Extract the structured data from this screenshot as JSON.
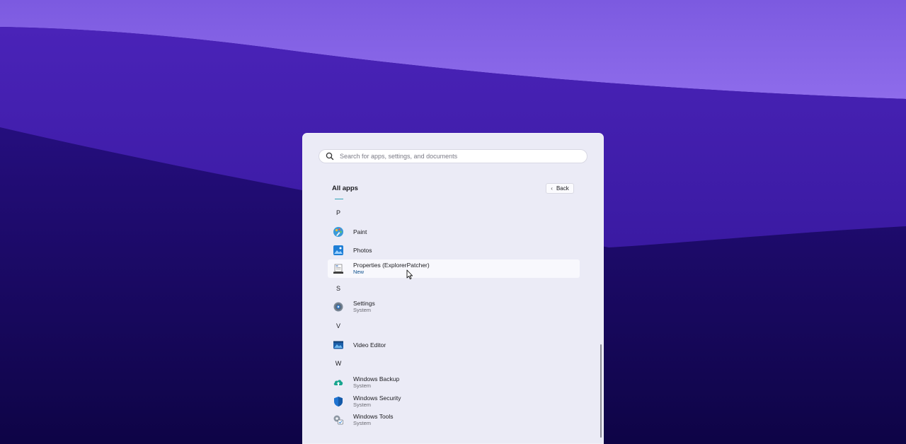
{
  "search": {
    "placeholder": "Search for apps, settings, and documents"
  },
  "header": {
    "title": "All apps",
    "back_label": "Back"
  },
  "groups": [
    {
      "letter": "P",
      "apps": [
        {
          "name": "Paint",
          "sub": "",
          "icon": "paint-icon"
        },
        {
          "name": "Photos",
          "sub": "",
          "icon": "photos-icon"
        },
        {
          "name": "Properties (ExplorerPatcher)",
          "sub": "New",
          "icon": "properties-icon"
        }
      ]
    },
    {
      "letter": "S",
      "apps": [
        {
          "name": "Settings",
          "sub": "System",
          "icon": "settings-icon"
        }
      ]
    },
    {
      "letter": "V",
      "apps": [
        {
          "name": "Video Editor",
          "sub": "",
          "icon": "video-editor-icon"
        }
      ]
    },
    {
      "letter": "W",
      "apps": [
        {
          "name": "Windows Backup",
          "sub": "System",
          "icon": "backup-icon"
        },
        {
          "name": "Windows Security",
          "sub": "System",
          "icon": "shield-icon"
        },
        {
          "name": "Windows Tools",
          "sub": "System",
          "icon": "tools-icon"
        }
      ]
    }
  ],
  "colors": {
    "accent": "#0b4f8c",
    "wallpaper_top": "#8a6ae6",
    "wallpaper_bottom": "#0d0340"
  }
}
